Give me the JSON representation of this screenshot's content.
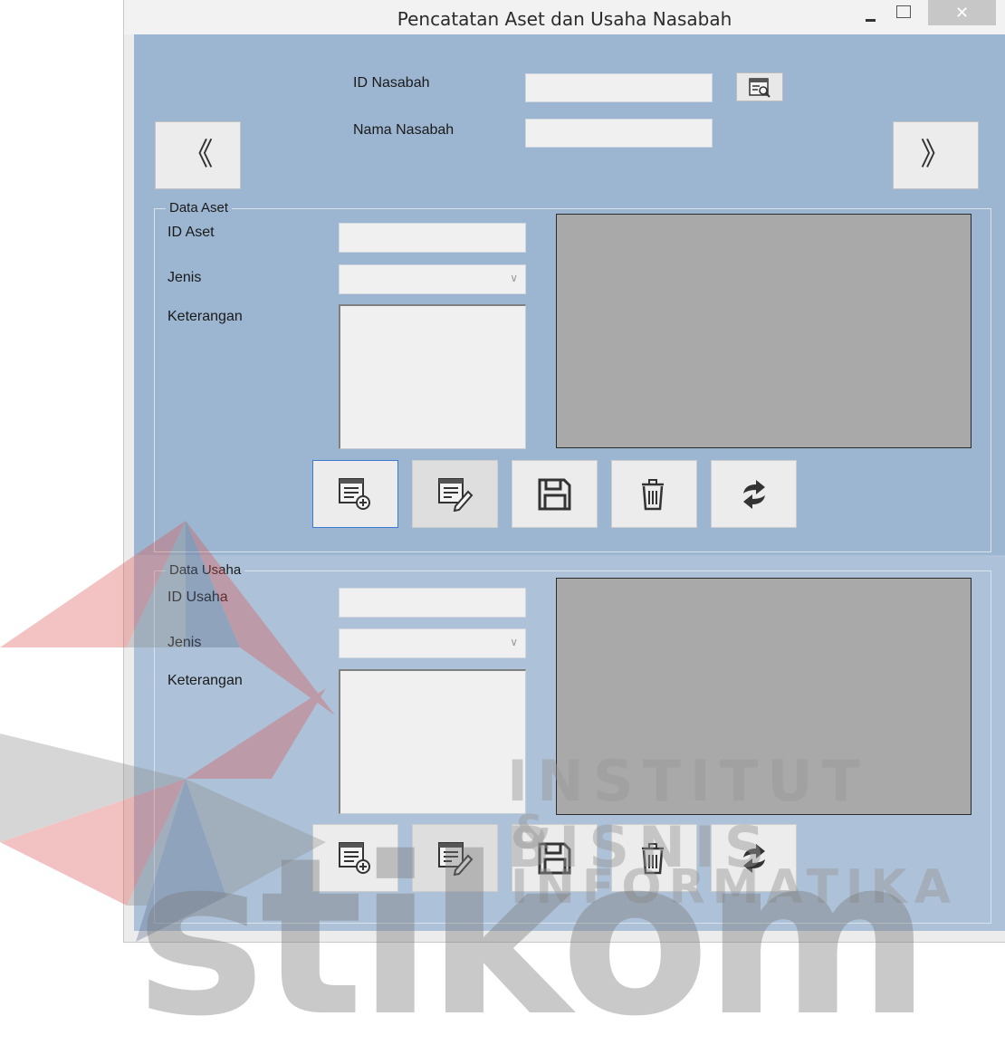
{
  "window": {
    "title": "Pencatatan Aset dan Usaha Nasabah",
    "minimize_label": "–",
    "close_label": "✕"
  },
  "customer": {
    "id_label": "ID Nasabah",
    "id_value": "",
    "name_label": "Nama Nasabah",
    "name_value": ""
  },
  "nav": {
    "prev_label": "《",
    "next_label": "》"
  },
  "aset": {
    "group_title": "Data Aset",
    "id_label": "ID Aset",
    "id_value": "",
    "jenis_label": "Jenis",
    "jenis_value": "",
    "keterangan_label": "Keterangan",
    "keterangan_value": ""
  },
  "usaha": {
    "group_title": "Data Usaha",
    "id_label": "ID Usaha",
    "id_value": "",
    "jenis_label": "Jenis",
    "jenis_value": "",
    "keterangan_label": "Keterangan",
    "keterangan_value": ""
  },
  "toolbar_icons": [
    "add-record-icon",
    "edit-record-icon",
    "save-icon",
    "delete-icon",
    "refresh-icon"
  ],
  "watermark": {
    "line1": "INSTITUT BISNIS",
    "line2": "& INFORMATIKA",
    "logo_text": "stikom"
  },
  "colors": {
    "client_bg": "#9cb6d1",
    "preview_bg": "#a9a9a9",
    "watermark_red": "#d9534f",
    "watermark_gray": "#8c8c8c"
  }
}
